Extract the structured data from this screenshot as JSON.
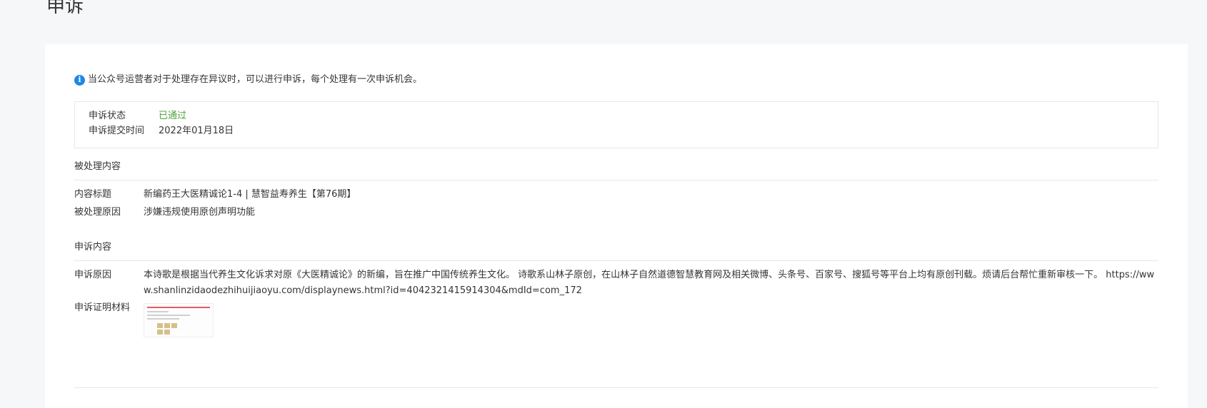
{
  "page": {
    "title": "申诉"
  },
  "notice": {
    "text": "当公众号运营者对于处理存在异议时，可以进行申诉，每个处理有一次申诉机会。",
    "icon": "info-icon",
    "icon_color": "#1e88e5"
  },
  "status": {
    "state_label": "申诉状态",
    "state_value": "已通过",
    "state_color": "#52a33c",
    "time_label": "申诉提交时间",
    "time_value": "2022年01月18日"
  },
  "processed": {
    "section_title": "被处理内容",
    "title_label": "内容标题",
    "title_value": "新编药王大医精诚论1-4 | 慧智益寿养生【第76期】",
    "reason_label": "被处理原因",
    "reason_value": "涉嫌违规使用原创声明功能"
  },
  "appeal": {
    "section_title": "申诉内容",
    "reason_label": "申诉原因",
    "reason_value": "本诗歌是根据当代养生文化诉求对原《大医精诚论》的新编，旨在推广中国传统养生文化。 诗歌系山林子原创，在山林子自然道德智慧教育网及相关微博、头条号、百家号、搜狐号等平台上均有原创刊载。烦请后台帮忙重新审核一下。 https://www.shanlinzidaodezhihuijiaoyu.com/displaynews.html?id=4042321415914304&mdId=com_172",
    "evidence_label": "申诉证明材料"
  }
}
